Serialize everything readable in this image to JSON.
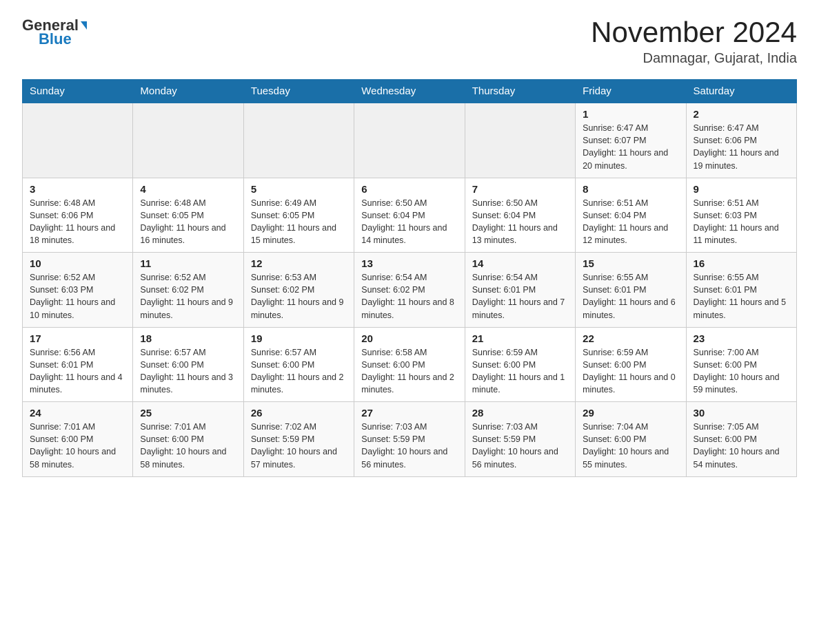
{
  "header": {
    "logo_general": "General",
    "logo_blue": "Blue",
    "month_year": "November 2024",
    "location": "Damnagar, Gujarat, India"
  },
  "days_of_week": [
    "Sunday",
    "Monday",
    "Tuesday",
    "Wednesday",
    "Thursday",
    "Friday",
    "Saturday"
  ],
  "weeks": [
    [
      {
        "day": "",
        "info": ""
      },
      {
        "day": "",
        "info": ""
      },
      {
        "day": "",
        "info": ""
      },
      {
        "day": "",
        "info": ""
      },
      {
        "day": "",
        "info": ""
      },
      {
        "day": "1",
        "info": "Sunrise: 6:47 AM\nSunset: 6:07 PM\nDaylight: 11 hours and 20 minutes."
      },
      {
        "day": "2",
        "info": "Sunrise: 6:47 AM\nSunset: 6:06 PM\nDaylight: 11 hours and 19 minutes."
      }
    ],
    [
      {
        "day": "3",
        "info": "Sunrise: 6:48 AM\nSunset: 6:06 PM\nDaylight: 11 hours and 18 minutes."
      },
      {
        "day": "4",
        "info": "Sunrise: 6:48 AM\nSunset: 6:05 PM\nDaylight: 11 hours and 16 minutes."
      },
      {
        "day": "5",
        "info": "Sunrise: 6:49 AM\nSunset: 6:05 PM\nDaylight: 11 hours and 15 minutes."
      },
      {
        "day": "6",
        "info": "Sunrise: 6:50 AM\nSunset: 6:04 PM\nDaylight: 11 hours and 14 minutes."
      },
      {
        "day": "7",
        "info": "Sunrise: 6:50 AM\nSunset: 6:04 PM\nDaylight: 11 hours and 13 minutes."
      },
      {
        "day": "8",
        "info": "Sunrise: 6:51 AM\nSunset: 6:04 PM\nDaylight: 11 hours and 12 minutes."
      },
      {
        "day": "9",
        "info": "Sunrise: 6:51 AM\nSunset: 6:03 PM\nDaylight: 11 hours and 11 minutes."
      }
    ],
    [
      {
        "day": "10",
        "info": "Sunrise: 6:52 AM\nSunset: 6:03 PM\nDaylight: 11 hours and 10 minutes."
      },
      {
        "day": "11",
        "info": "Sunrise: 6:52 AM\nSunset: 6:02 PM\nDaylight: 11 hours and 9 minutes."
      },
      {
        "day": "12",
        "info": "Sunrise: 6:53 AM\nSunset: 6:02 PM\nDaylight: 11 hours and 9 minutes."
      },
      {
        "day": "13",
        "info": "Sunrise: 6:54 AM\nSunset: 6:02 PM\nDaylight: 11 hours and 8 minutes."
      },
      {
        "day": "14",
        "info": "Sunrise: 6:54 AM\nSunset: 6:01 PM\nDaylight: 11 hours and 7 minutes."
      },
      {
        "day": "15",
        "info": "Sunrise: 6:55 AM\nSunset: 6:01 PM\nDaylight: 11 hours and 6 minutes."
      },
      {
        "day": "16",
        "info": "Sunrise: 6:55 AM\nSunset: 6:01 PM\nDaylight: 11 hours and 5 minutes."
      }
    ],
    [
      {
        "day": "17",
        "info": "Sunrise: 6:56 AM\nSunset: 6:01 PM\nDaylight: 11 hours and 4 minutes."
      },
      {
        "day": "18",
        "info": "Sunrise: 6:57 AM\nSunset: 6:00 PM\nDaylight: 11 hours and 3 minutes."
      },
      {
        "day": "19",
        "info": "Sunrise: 6:57 AM\nSunset: 6:00 PM\nDaylight: 11 hours and 2 minutes."
      },
      {
        "day": "20",
        "info": "Sunrise: 6:58 AM\nSunset: 6:00 PM\nDaylight: 11 hours and 2 minutes."
      },
      {
        "day": "21",
        "info": "Sunrise: 6:59 AM\nSunset: 6:00 PM\nDaylight: 11 hours and 1 minute."
      },
      {
        "day": "22",
        "info": "Sunrise: 6:59 AM\nSunset: 6:00 PM\nDaylight: 11 hours and 0 minutes."
      },
      {
        "day": "23",
        "info": "Sunrise: 7:00 AM\nSunset: 6:00 PM\nDaylight: 10 hours and 59 minutes."
      }
    ],
    [
      {
        "day": "24",
        "info": "Sunrise: 7:01 AM\nSunset: 6:00 PM\nDaylight: 10 hours and 58 minutes."
      },
      {
        "day": "25",
        "info": "Sunrise: 7:01 AM\nSunset: 6:00 PM\nDaylight: 10 hours and 58 minutes."
      },
      {
        "day": "26",
        "info": "Sunrise: 7:02 AM\nSunset: 5:59 PM\nDaylight: 10 hours and 57 minutes."
      },
      {
        "day": "27",
        "info": "Sunrise: 7:03 AM\nSunset: 5:59 PM\nDaylight: 10 hours and 56 minutes."
      },
      {
        "day": "28",
        "info": "Sunrise: 7:03 AM\nSunset: 5:59 PM\nDaylight: 10 hours and 56 minutes."
      },
      {
        "day": "29",
        "info": "Sunrise: 7:04 AM\nSunset: 6:00 PM\nDaylight: 10 hours and 55 minutes."
      },
      {
        "day": "30",
        "info": "Sunrise: 7:05 AM\nSunset: 6:00 PM\nDaylight: 10 hours and 54 minutes."
      }
    ]
  ]
}
